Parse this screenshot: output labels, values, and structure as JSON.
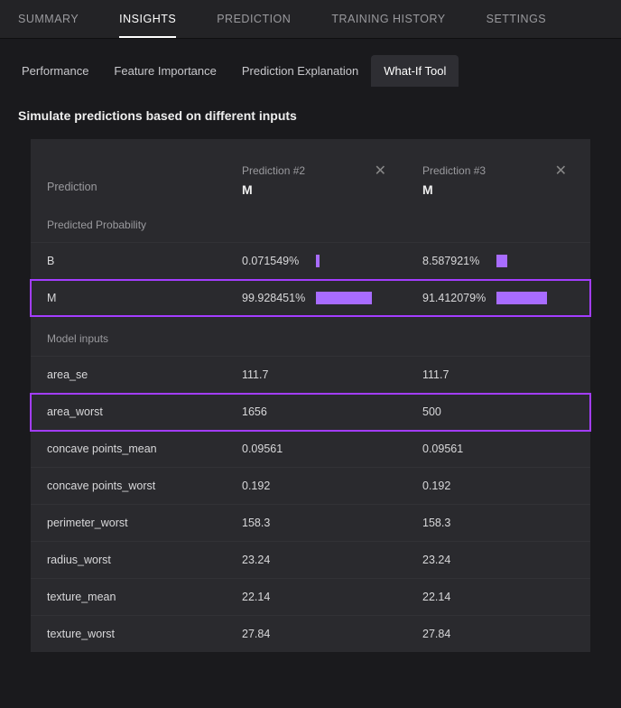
{
  "topTabs": {
    "summary": "SUMMARY",
    "insights": "INSIGHTS",
    "prediction": "PREDICTION",
    "training": "TRAINING HISTORY",
    "settings": "SETTINGS"
  },
  "subTabs": {
    "performance": "Performance",
    "featureImportance": "Feature Importance",
    "predictionExplanation": "Prediction Explanation",
    "whatIf": "What-If Tool"
  },
  "sectionTitle": "Simulate predictions based on different inputs",
  "table": {
    "predictionLabel": "Prediction",
    "predProbLabel": "Predicted Probability",
    "modelInputsLabel": "Model inputs",
    "col2": {
      "header": "Prediction #2",
      "class": "M"
    },
    "col3": {
      "header": "Prediction #3",
      "class": "M"
    },
    "classB": "B",
    "classM": "M",
    "probB2": "0.071549%",
    "probB3": "8.587921%",
    "probM2": "99.928451%",
    "probM3": "91.412079%",
    "inputs": {
      "area_se": {
        "label": "area_se",
        "v2": "111.7",
        "v3": "111.7"
      },
      "area_worst": {
        "label": "area_worst",
        "v2": "1656",
        "v3": "500"
      },
      "concave_mean": {
        "label": "concave points_mean",
        "v2": "0.09561",
        "v3": "0.09561"
      },
      "concave_worst": {
        "label": "concave points_worst",
        "v2": "0.192",
        "v3": "0.192"
      },
      "perimeter_worst": {
        "label": "perimeter_worst",
        "v2": "158.3",
        "v3": "158.3"
      },
      "radius_worst": {
        "label": "radius_worst",
        "v2": "23.24",
        "v3": "23.24"
      },
      "texture_mean": {
        "label": "texture_mean",
        "v2": "22.14",
        "v3": "22.14"
      },
      "texture_worst": {
        "label": "texture_worst",
        "v2": "27.84",
        "v3": "27.84"
      }
    }
  }
}
